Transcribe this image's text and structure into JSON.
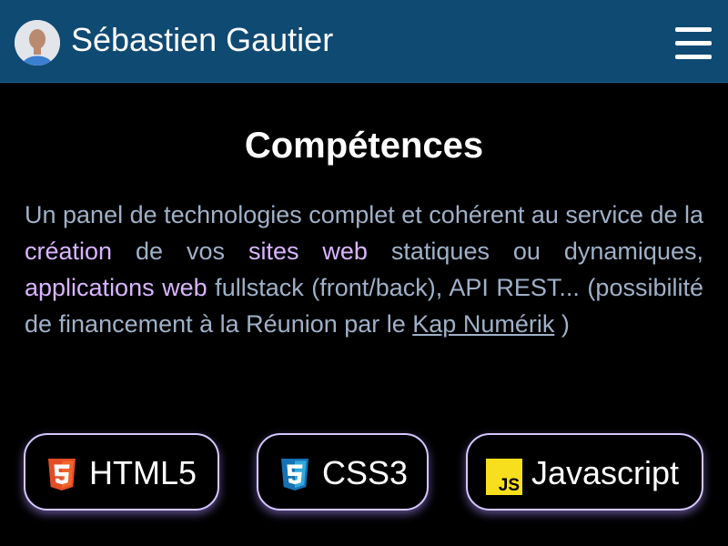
{
  "header": {
    "site_name": "Sébastien Gautier",
    "avatar_icon": "profile-photo",
    "menu_icon": "hamburger-menu-icon",
    "background_color": "#0f4a73"
  },
  "section": {
    "title": "Compétences",
    "intro": {
      "part1": "Un panel de technologies complet et cohérent au service de la ",
      "highlight1": "création",
      "part2": " de vos ",
      "highlight2": "sites web",
      "part3": " statiques ou dynamiques, ",
      "highlight3": "applications web",
      "part4": " fullstack (front/back), API REST... (possibilité de financement à la Réunion par le ",
      "link": "Kap Numérik",
      "part5": " )"
    },
    "text_color": "#9fb1c8",
    "highlight_color": "#d9b5ff"
  },
  "skills": [
    {
      "label": "HTML5",
      "icon": "html5-logo-icon",
      "color": "#e44d26"
    },
    {
      "label": "CSS3",
      "icon": "css3-logo-icon",
      "color": "#1572b6"
    },
    {
      "label": "Javascript",
      "icon": "javascript-logo-icon",
      "color": "#f7df1e"
    }
  ],
  "skill_border_color": "#d4c7ff"
}
